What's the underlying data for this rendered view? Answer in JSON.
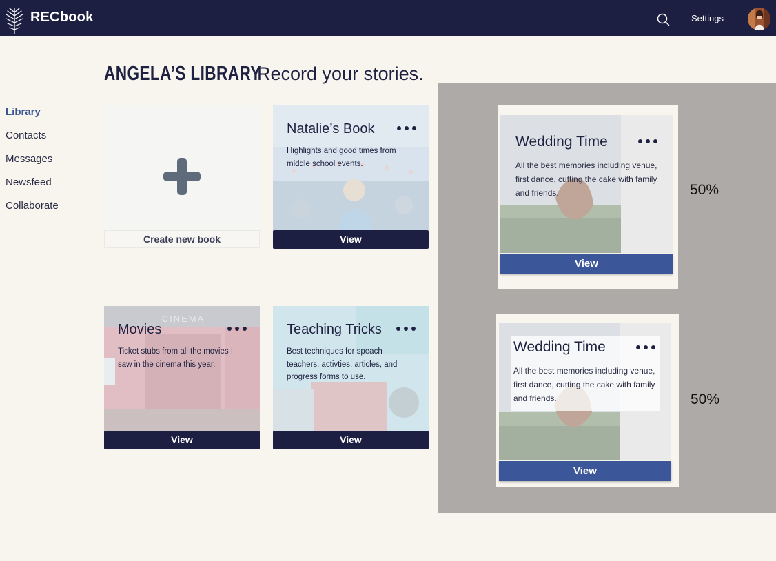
{
  "app": {
    "brand": "RECbook",
    "settings_label": "Settings"
  },
  "header": {
    "title": "ANGELA’S LIBRARY",
    "subtitle": "Record your stories."
  },
  "sidebar": {
    "items": [
      {
        "label": "Library",
        "active": true
      },
      {
        "label": "Contacts"
      },
      {
        "label": "Messages"
      },
      {
        "label": "Newsfeed"
      },
      {
        "label": "Collaborate"
      }
    ]
  },
  "create_card": {
    "label": "Create new book"
  },
  "books": [
    {
      "title": "Natalie’s Book",
      "desc": "Highlights and good times from middle school events.",
      "view": "View"
    },
    {
      "title": "Movies",
      "desc": "Ticket stubs from all the movies I saw in the cinema this year.",
      "view": "View",
      "image_text": "CINEMA"
    },
    {
      "title": "Teaching Tricks",
      "desc": "Best techniques for speach teachers, activties, articles, and progress forms to use.",
      "view": "View"
    }
  ],
  "opacity_demos": [
    {
      "title": "Wedding Time",
      "desc": "All the best memories including venue, first dance, cutting the cake with family and friends.",
      "view": "View",
      "opacity": "50%"
    },
    {
      "title": "Wedding Time",
      "desc": "All the best memories including venue, first dance, cutting the cake with family and friends.",
      "view": "View",
      "opacity": "50%"
    }
  ],
  "icons": {
    "logo": "palm-leaf-icon",
    "search": "search-icon",
    "more": "more-dots-icon",
    "add": "plus-icon"
  },
  "colors": {
    "nav": "#1c1f41",
    "accent": "#3b5799",
    "background": "#f8f5ef",
    "overlay": "#aeaaa8"
  }
}
